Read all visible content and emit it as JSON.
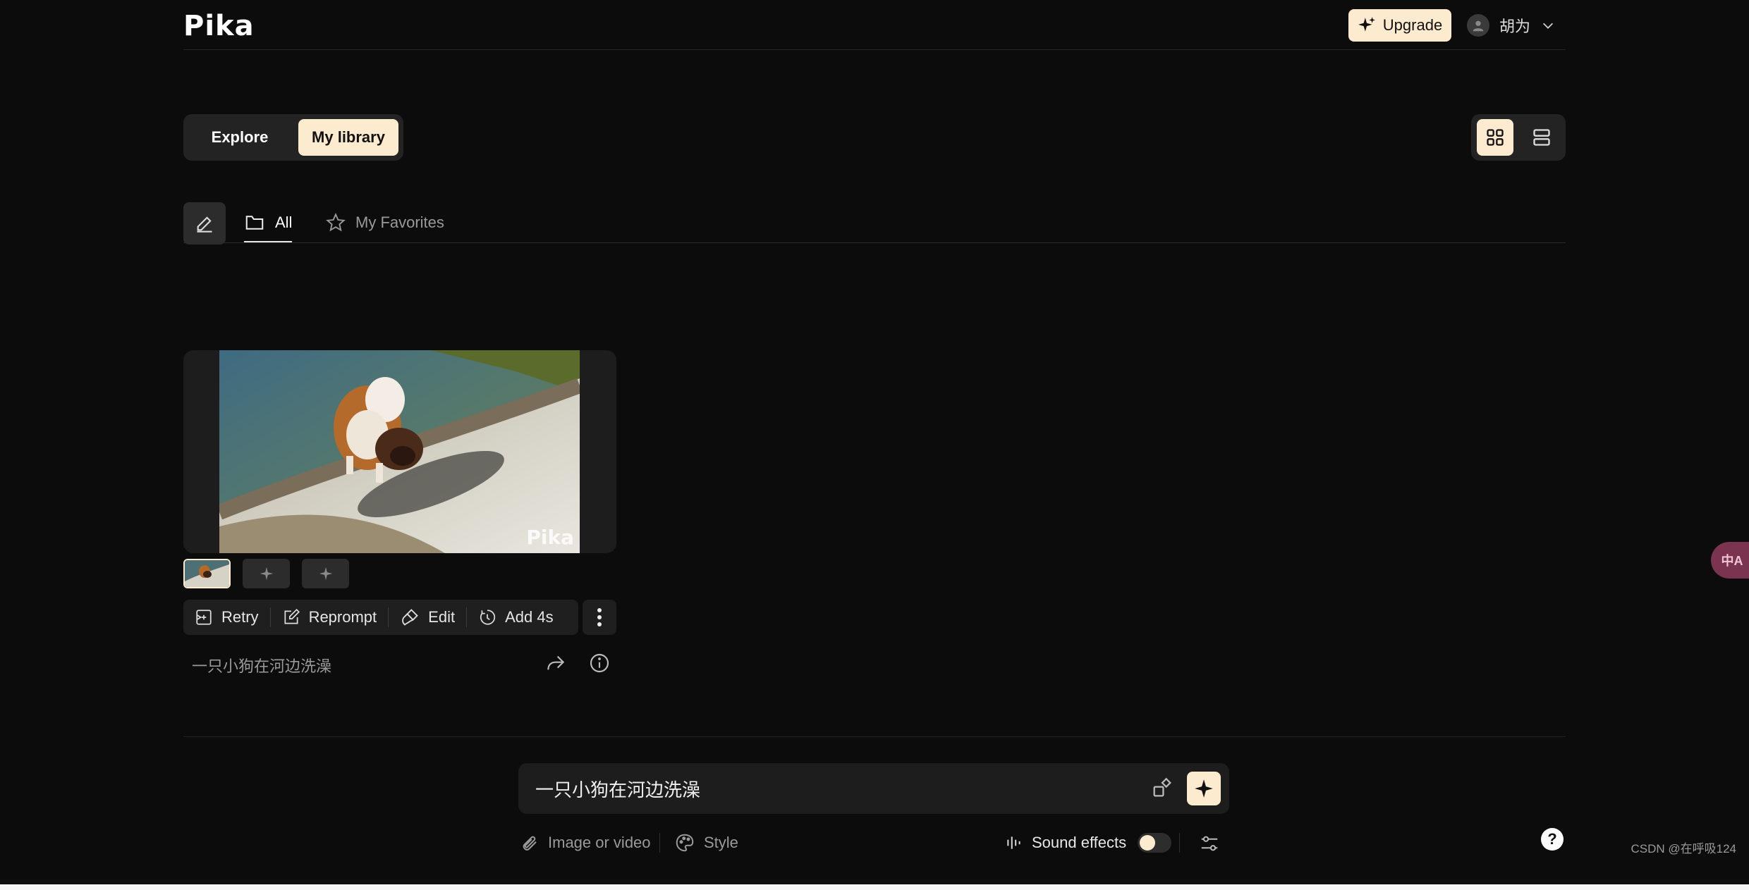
{
  "header": {
    "logo": "Pika",
    "upgrade_label": "Upgrade",
    "user_name": "胡为"
  },
  "view_tabs": [
    {
      "label": "Explore",
      "active": false
    },
    {
      "label": "My library",
      "active": true
    }
  ],
  "layout_toggle": {
    "active": "grid-icon",
    "options": [
      "grid-icon",
      "list-icon"
    ]
  },
  "filter_tabs": [
    {
      "label": "All",
      "icon": "folder-icon",
      "active": true
    },
    {
      "label": "My Favorites",
      "icon": "star-icon",
      "active": false
    }
  ],
  "video": {
    "watermark": "Pika",
    "prompt": "一只小狗在河边洗澡",
    "actions": [
      {
        "label": "Retry",
        "icon": "retry-icon"
      },
      {
        "label": "Reprompt",
        "icon": "edit-square-icon"
      },
      {
        "label": "Edit",
        "icon": "brush-icon"
      },
      {
        "label": "Add 4s",
        "icon": "timer-icon"
      }
    ]
  },
  "composer": {
    "value": "一只小狗在河边洗澡",
    "image_label": "Image or video",
    "style_label": "Style",
    "sound_label": "Sound effects",
    "sound_on": false
  },
  "help_label": "?",
  "translate_label": "中A",
  "credit": "CSDN @在呼吸124",
  "colors": {
    "accent": "#fdebd0",
    "background": "#0c0c0c",
    "panel": "#232323"
  }
}
